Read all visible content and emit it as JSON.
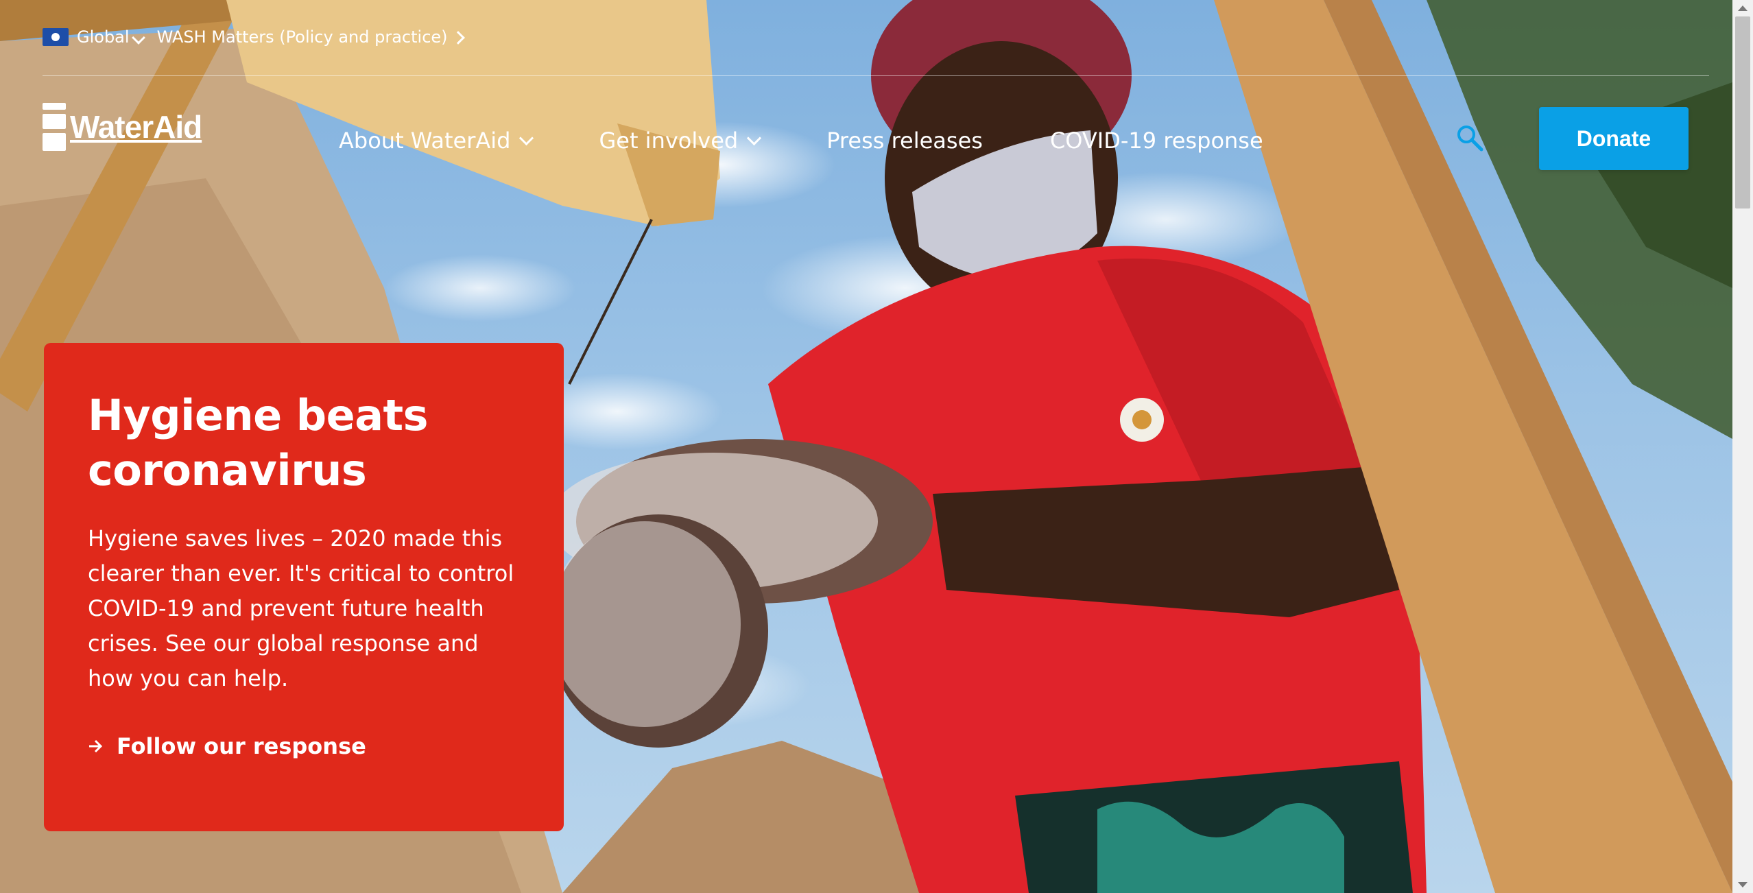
{
  "utility": {
    "region": "Global",
    "link": "WASH Matters (Policy and practice)",
    "flag_icon": "globe-flag-icon"
  },
  "logo": {
    "text": "WaterAid"
  },
  "nav": {
    "items": [
      {
        "label": "About WaterAid",
        "has_dropdown": true
      },
      {
        "label": "Get involved",
        "has_dropdown": true
      },
      {
        "label": "Press releases",
        "has_dropdown": false
      },
      {
        "label": "COVID-19 response",
        "has_dropdown": false
      }
    ],
    "search_icon": "search-icon",
    "donate_label": "Donate"
  },
  "hero": {
    "title": "Hygiene beats coronavirus",
    "body": "Hygiene saves lives – 2020 made this clearer than ever. It's critical to control COVID-19 and prevent future health crises. See our global response and how you can help.",
    "cta": "Follow our response"
  },
  "colors": {
    "card": "#e0291b",
    "donate": "#0aa0e6",
    "text": "#ffffff"
  }
}
